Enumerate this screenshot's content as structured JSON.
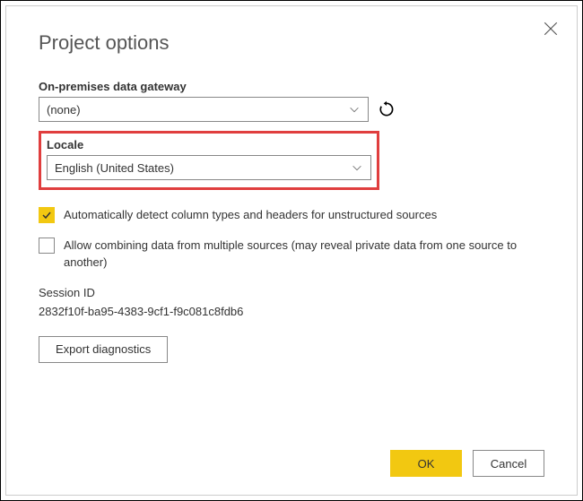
{
  "dialog": {
    "title": "Project options",
    "close_icon": "close"
  },
  "gateway": {
    "label": "On-premises data gateway",
    "value": "(none)",
    "refresh_icon": "refresh"
  },
  "locale": {
    "label": "Locale",
    "value": "English (United States)"
  },
  "checkboxes": {
    "auto_detect": {
      "checked": true,
      "label": "Automatically detect column types and headers for unstructured sources"
    },
    "allow_combine": {
      "checked": false,
      "label": "Allow combining data from multiple sources (may reveal private data from one source to another)"
    }
  },
  "session": {
    "label": "Session ID",
    "value": "2832f10f-ba95-4383-9cf1-f9c081c8fdb6"
  },
  "buttons": {
    "export": "Export diagnostics",
    "ok": "OK",
    "cancel": "Cancel"
  },
  "colors": {
    "accent": "#f2c811",
    "highlight": "#e03e3e"
  }
}
